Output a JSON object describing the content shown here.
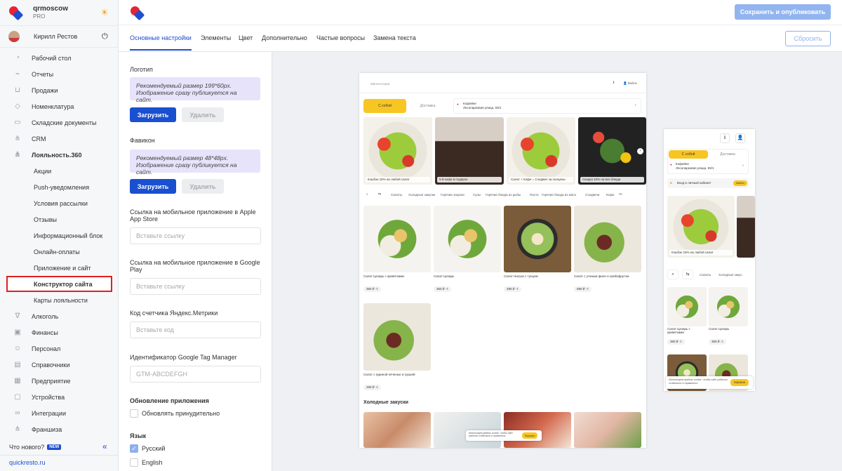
{
  "app": {
    "name": "qrmoscow",
    "plan": "PRO"
  },
  "user": {
    "name": "Кирилл Рестов"
  },
  "menu": [
    {
      "label": "Рабочий стол",
      "icon": "speedometer-icon",
      "glyph": "◔"
    },
    {
      "label": "Отчеты",
      "icon": "chart-icon",
      "glyph": "⌁"
    },
    {
      "label": "Продажи",
      "icon": "basket-icon",
      "glyph": "⊔"
    },
    {
      "label": "Номенклатура",
      "icon": "tag-icon",
      "glyph": "◇"
    },
    {
      "label": "Складские документы",
      "icon": "warehouse-icon",
      "glyph": "▭"
    },
    {
      "label": "CRM",
      "icon": "hierarchy-icon",
      "glyph": "⋔"
    },
    {
      "label": "Лояльность.360",
      "icon": "hierarchy-icon",
      "glyph": "⋔"
    }
  ],
  "submenu": [
    "Акции",
    "Push-уведомления",
    "Условия рассылки",
    "Отзывы",
    "Информационный блок",
    "Онлайн-оплаты",
    "Приложение и сайт",
    "Конструктор сайта",
    "Карты лояльности"
  ],
  "menu2": [
    {
      "label": "Алкоголь",
      "icon": "glass-icon",
      "glyph": "∇"
    },
    {
      "label": "Финансы",
      "icon": "wallet-icon",
      "glyph": "▣"
    },
    {
      "label": "Персонал",
      "icon": "people-icon",
      "glyph": "☺"
    },
    {
      "label": "Справочники",
      "icon": "book-icon",
      "glyph": "▤"
    },
    {
      "label": "Предприятие",
      "icon": "building-icon",
      "glyph": "▦"
    },
    {
      "label": "Устройства",
      "icon": "device-icon",
      "glyph": "▢"
    },
    {
      "label": "Интеграции",
      "icon": "infinity-icon",
      "glyph": "∞"
    },
    {
      "label": "Франшиза",
      "icon": "hierarchy-icon",
      "glyph": "⋔"
    }
  ],
  "footer": {
    "whats_new": "Что нового?",
    "new_badge": "NEW",
    "link": "quickresto.ru"
  },
  "toolbar": {
    "save_label": "Сохранить и опубликовать",
    "reset_label": "Сбросить"
  },
  "tabs": [
    "Основные настройки",
    "Элементы",
    "Цвет",
    "Дополнительно",
    "Частые вопросы",
    "Замена текста"
  ],
  "form": {
    "logo_label": "Логотип",
    "logo_hint_1": "Рекомендуемый размер 199*60px.",
    "logo_hint_2": "Изображение сразу публикуется на сайт.",
    "upload_label": "Загрузить",
    "delete_label": "Удалить",
    "favicon_label": "Фавикон",
    "favicon_hint_1": "Рекомендуемый размер 48*48px.",
    "favicon_hint_2": "Изображение сразу публикуется на сайт.",
    "appstore_label_1": "Ссылка на мобильное приложение в Apple",
    "appstore_label_2": "App Store",
    "appstore_placeholder": "Вставьте ссылку",
    "gplay_label_1": "Ссылка на мобильное приложение в Google",
    "gplay_label_2": "Play",
    "gplay_placeholder": "Вставьте ссылку",
    "metrika_label": "Код счетчика Яндекс.Метрики",
    "metrika_placeholder": "Вставьте код",
    "gtm_label": "Идентификатор Google Tag Manager",
    "gtm_placeholder": "GTM-ABCDEFGH",
    "update_label": "Обновление приложения",
    "force_update_label": "Обновлять принудительно",
    "lang_label": "Язык",
    "lang_ru": "Русский",
    "lang_en": "English"
  },
  "preview": {
    "site_name": "Магнитопора",
    "login": "Войти",
    "pickup": "С собой",
    "delivery": "Доставка",
    "place": "Кофейне",
    "address": "Лесопарковая улица, 93/1",
    "banners": [
      "Кэшбэк 15% на любой салат",
      "5-й кофе в подарок",
      "Салат + Кофе = Сэндвич за полцены",
      "Скидка 10% на все блюда"
    ],
    "categories": [
      "Салаты",
      "Холодные закуски",
      "Горячие закуски",
      "Супы",
      "Горячие блюда из рыбы",
      "Паста",
      "Горячие блюда из мяса",
      "Сэндвичи",
      "Кофе"
    ],
    "products": [
      {
        "name": "Салат Цезарь с креветками",
        "price": "350 ₽"
      },
      {
        "name": "Салат Цезарь",
        "price": "350 ₽"
      },
      {
        "name": "Салат Нисуаз с тунцом",
        "price": "290 ₽"
      },
      {
        "name": "Салат с утиным филе и грейпфрутом",
        "price": "590 ₽"
      },
      {
        "name": "Салат с куриной печенью и грушей",
        "price": "290 ₽"
      }
    ],
    "section2": "Холодные закуски",
    "cookie_text": "Используем файлы cookie, чтобы сайт работал стабильно и правильно",
    "cookie_btn": "Хорошо",
    "mob_cabinet": "Вход в личный кабинет",
    "mob_login": "Войти",
    "mob_banner": "Кэшбэк 15% на любой салат",
    "mob_cats": [
      "Салаты",
      "Холодные закус"
    ],
    "mob_products": [
      {
        "name": "Салат Цезарь с креветками",
        "price": "350 ₽"
      },
      {
        "name": "Салат Цезарь",
        "price": "350 ₽"
      }
    ]
  },
  "colors": {
    "accent": "#1f4fd0",
    "brand_red": "#e62434",
    "highlight": "#e02020",
    "yellow": "#f8c623"
  }
}
